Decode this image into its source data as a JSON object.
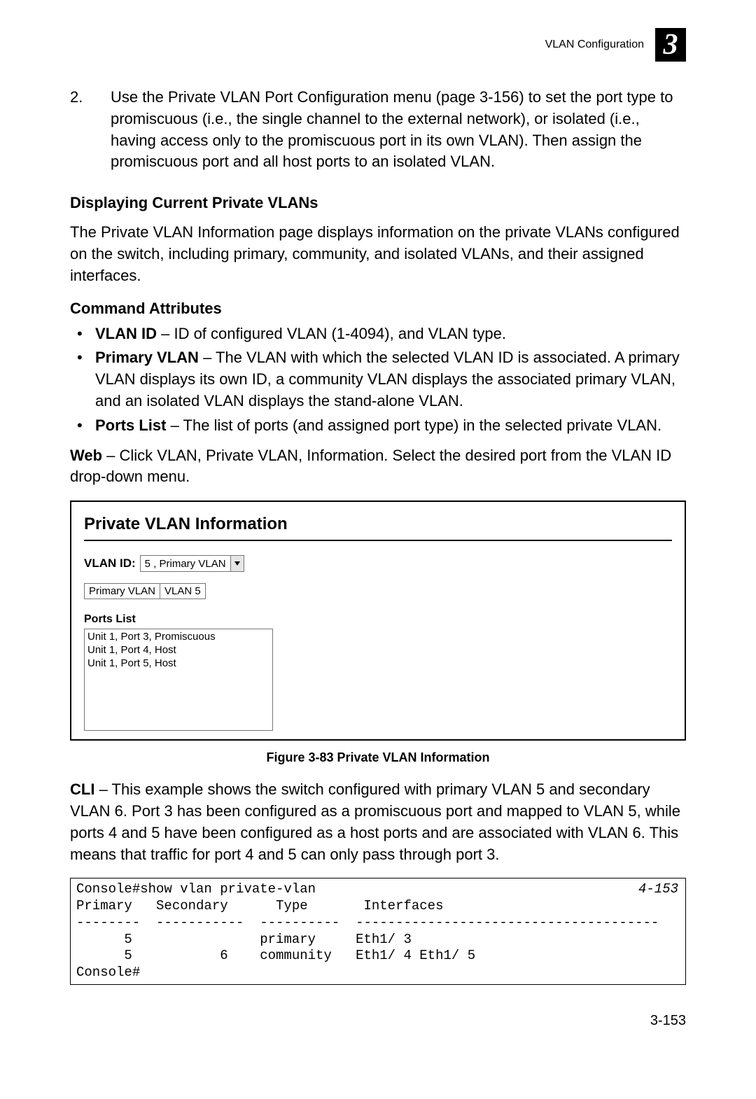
{
  "header": {
    "title": "VLAN Configuration",
    "chapter": "3"
  },
  "step": {
    "num": "2.",
    "text": "Use the Private VLAN Port Configuration menu (page 3-156) to set the port type to promiscuous (i.e., the single channel to the external network), or isolated (i.e., having access only to the promiscuous port in its own VLAN). Then assign the promiscuous port and all host ports to an isolated VLAN."
  },
  "section_heading": "Displaying Current Private VLANs",
  "intro": "The Private VLAN Information page displays information on the private VLANs configured on the switch, including primary, community, and isolated VLANs, and their assigned interfaces.",
  "cmd_attr_heading": "Command Attributes",
  "bullets": [
    {
      "term": "VLAN ID",
      "text": " – ID of configured VLAN (1-4094), and VLAN type."
    },
    {
      "term": "Primary VLAN",
      "text": " – The VLAN with which the selected VLAN ID is associated. A primary VLAN displays its own ID, a community VLAN displays the associated primary VLAN, and an isolated VLAN displays the stand-alone VLAN."
    },
    {
      "term": "Ports List",
      "text": " – The list of ports (and assigned port type) in the selected private VLAN."
    }
  ],
  "web_para": {
    "prefix": "Web",
    "text": " – Click VLAN, Private VLAN, Information. Select the desired port from the VLAN ID drop-down menu."
  },
  "figure": {
    "panel_title": "Private VLAN Information",
    "vlan_id_label": "VLAN ID:",
    "vlan_id_value": "5 , Primary VLAN",
    "pv_table": {
      "h": "Primary VLAN",
      "v": "VLAN 5"
    },
    "ports_label": "Ports List",
    "ports": [
      "Unit 1, Port 3, Promiscuous",
      "Unit 1, Port 4, Host",
      "Unit 1, Port 5, Host"
    ],
    "caption": "Figure 3-83  Private VLAN Information"
  },
  "cli_para": {
    "prefix": "CLI",
    "text": " – This example shows the switch configured with primary VLAN 5 and secondary VLAN 6. Port 3 has been configured as a promiscuous port and mapped to VLAN 5, while ports 4 and 5 have been configured as a host ports and are associated with VLAN 6. This means that traffic for port 4 and 5 can only pass through port 3."
  },
  "code": {
    "ref": "4-153",
    "body": "Console#show vlan private-vlan\nPrimary   Secondary      Type       Interfaces\n--------  -----------  ----------  --------------------------------------\n      5                primary     Eth1/ 3\n      5           6    community   Eth1/ 4 Eth1/ 5\nConsole#"
  },
  "page_num": "3-153"
}
